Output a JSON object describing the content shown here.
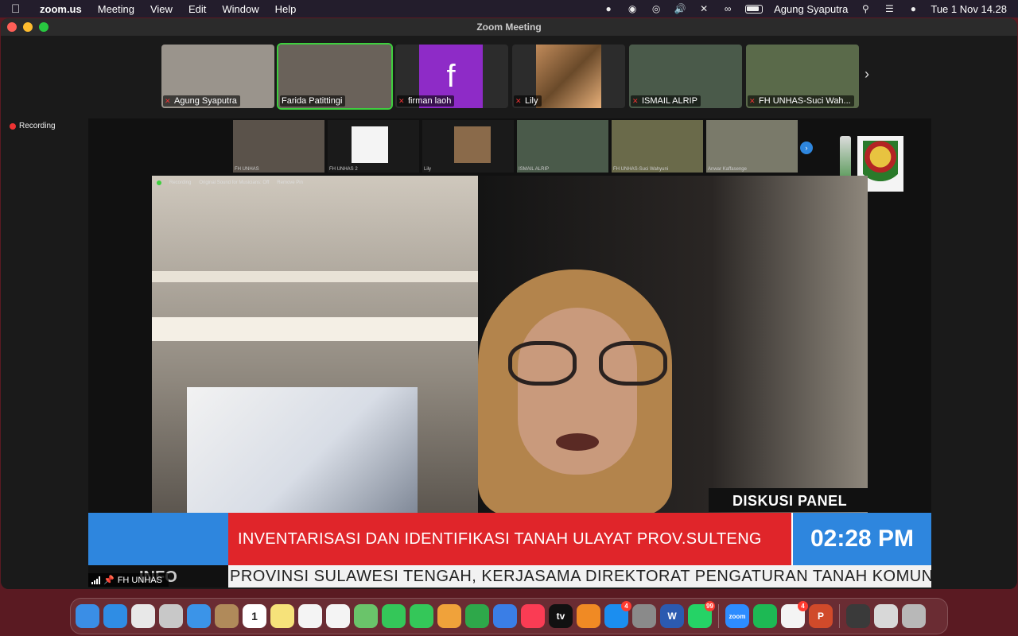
{
  "menubar": {
    "apple": "",
    "app_name": "zoom.us",
    "menus": [
      "Meeting",
      "View",
      "Edit",
      "Window",
      "Help"
    ],
    "user": "Agung Syaputra",
    "clock": "Tue 1 Nov  14.28"
  },
  "window": {
    "title": "Zoom Meeting"
  },
  "participants": [
    {
      "name": "Agung Syaputra",
      "bg": "#9a948c"
    },
    {
      "name": "Farida Patittingi",
      "bg": "#6a625a"
    },
    {
      "name": "firman laoh",
      "bg": "#2c2c2c",
      "initial": "f"
    },
    {
      "name": "Lily",
      "bg": "#8a5a3a"
    },
    {
      "name": "ISMAIL ALRIP",
      "bg": "#4a5a4a"
    },
    {
      "name": "FH UNHAS-Suci Wah...",
      "bg": "#5a6a4a"
    }
  ],
  "recording_label": "Recording",
  "shared_screen": {
    "inner_participants": [
      "FH UNHAS",
      "FH UNHAS 2",
      "Lily",
      "ISMAIL ALRIP",
      "FH UNHAS-Suci Wahyuni",
      "Anwar Kaffasenge"
    ],
    "inner_recording": "Recording",
    "inner_audio": "Original Sound for Musicians: Off",
    "inner_pin": "Remove Pin",
    "panel_label": "DISKUSI PANEL",
    "headline": "INVENTARISASI DAN IDENTIFIKASI TANAH ULAYAT PROV.SULTENG",
    "time": "02:28 PM",
    "info_label": "INFO",
    "ticker": "PROVINSI SULAWESI TENGAH, KERJASAMA DIREKTORAT PENGATURAN TANAH KOMUNAL, H"
  },
  "active_speaker": {
    "name": "FH UNHAS"
  },
  "dock": [
    {
      "name": "finder",
      "color": "#3a8ee6"
    },
    {
      "name": "safari",
      "color": "#2f8de4"
    },
    {
      "name": "chrome",
      "color": "#e8e8e8"
    },
    {
      "name": "launchpad",
      "color": "#c8c8c8"
    },
    {
      "name": "mail",
      "color": "#3b94e8"
    },
    {
      "name": "contacts",
      "color": "#b08a5a"
    },
    {
      "name": "calendar",
      "color": "#ffffff",
      "label": "1"
    },
    {
      "name": "notes",
      "color": "#f6e27a"
    },
    {
      "name": "reminders",
      "color": "#f4f4f4"
    },
    {
      "name": "photos",
      "color": "#f4f4f4"
    },
    {
      "name": "maps",
      "color": "#6ac46a"
    },
    {
      "name": "messages",
      "color": "#34c759"
    },
    {
      "name": "facetime",
      "color": "#34c759"
    },
    {
      "name": "pages",
      "color": "#f0a23a"
    },
    {
      "name": "numbers",
      "color": "#2ea84a"
    },
    {
      "name": "keynote",
      "color": "#3a7ee6"
    },
    {
      "name": "music",
      "color": "#fa3c54"
    },
    {
      "name": "tv",
      "color": "#111111",
      "label": "tv"
    },
    {
      "name": "books",
      "color": "#f08a24"
    },
    {
      "name": "app-store",
      "color": "#1b8ef0",
      "badge": "4"
    },
    {
      "name": "system-preferences",
      "color": "#8a8a8a"
    },
    {
      "name": "word",
      "color": "#2b5ab0",
      "label": "W"
    },
    {
      "name": "whatsapp",
      "color": "#25d366",
      "badge": "99"
    },
    {
      "name": "zoom",
      "color": "#2d8cff",
      "label": "zoom"
    },
    {
      "name": "spotify",
      "color": "#1db954"
    },
    {
      "name": "microsoft-office",
      "color": "#f4f4f4",
      "badge": "4"
    },
    {
      "name": "powerpoint",
      "color": "#d04a2a",
      "label": "P"
    },
    {
      "name": "screenshot",
      "color": "#3a3a3a"
    },
    {
      "name": "downloads",
      "color": "#d8d8d8"
    },
    {
      "name": "trash",
      "color": "#b8b8b8"
    }
  ]
}
